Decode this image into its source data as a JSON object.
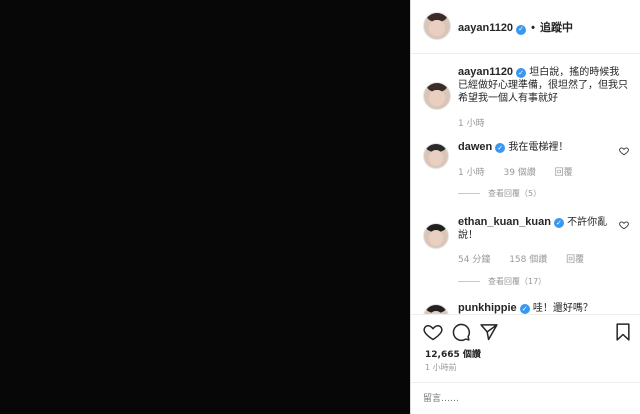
{
  "post": {
    "username": "aayan1120",
    "follow_status": "追蹤中",
    "dot": "•"
  },
  "caption": {
    "username": "aayan1120",
    "text": "坦白說，搖的時候我已經做好心理準備，很坦然了，但我只希望我一個人有事就好",
    "time": "1 小時"
  },
  "comments": [
    {
      "username": "dawen",
      "text": "我在電梯裡！",
      "time": "1 小時",
      "likes": "39 個讚",
      "reply": "回覆",
      "view_replies": "查看回覆（5）"
    },
    {
      "username": "ethan_kuan_kuan",
      "text": "不許你亂說！",
      "time": "54 分鐘",
      "likes": "158 個讚",
      "reply": "回覆",
      "view_replies": "查看回覆（17）"
    },
    {
      "username": "punkhippie",
      "text": "哇！還好嗎？"
    }
  ],
  "likes_count": "12,665 個讚",
  "time_ago": "1 小時前",
  "comment_placeholder": "留言……",
  "colors": {
    "verified": "#3897f0",
    "muted": "#999999",
    "text": "#262626"
  }
}
